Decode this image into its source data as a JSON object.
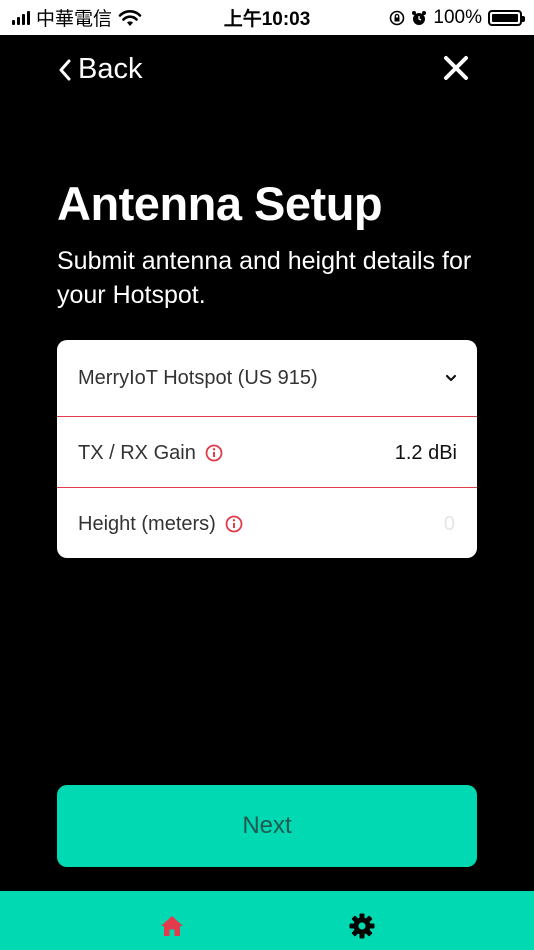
{
  "status_bar": {
    "carrier": "中華電信",
    "time": "上午10:03",
    "battery": "100%",
    "battery_level": 1.0
  },
  "nav": {
    "back_label": "Back",
    "close_icon": "close-icon"
  },
  "header": {
    "title": "Antenna Setup",
    "subtitle": "Submit antenna and height details for your Hotspot."
  },
  "form": {
    "antenna": {
      "selected": "MerryIoT Hotspot (US 915)"
    },
    "gain": {
      "label": "TX / RX Gain",
      "value": "1.2 dBi"
    },
    "height": {
      "label": "Height (meters)",
      "placeholder": "0"
    }
  },
  "actions": {
    "next_label": "Next"
  },
  "tab_bar": {
    "items": [
      {
        "icon": "home-icon",
        "active": true
      },
      {
        "icon": "gear-icon",
        "active": false
      }
    ]
  },
  "colors": {
    "accent": "#00d9b1",
    "divider": "#e23b4b",
    "home_icon": "#e23b4b"
  }
}
